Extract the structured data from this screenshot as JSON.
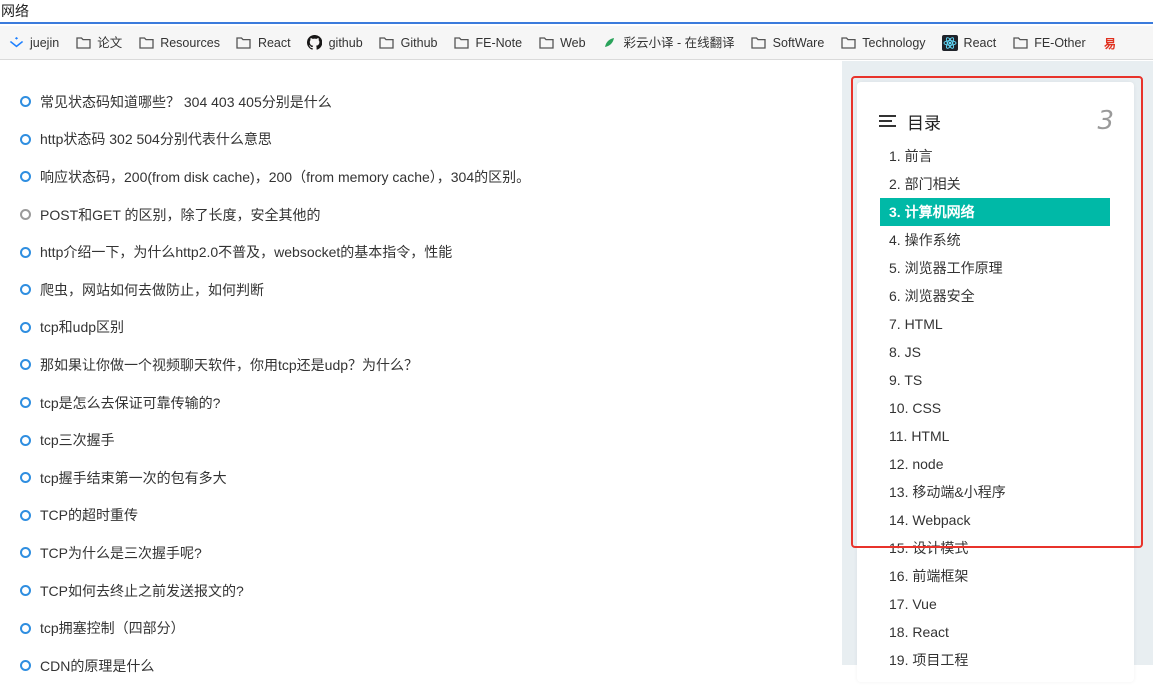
{
  "tab": {
    "title": "网络"
  },
  "bookmarks": [
    {
      "label": "juejin",
      "icon": "juejin-icon"
    },
    {
      "label": "论文",
      "icon": "folder-icon"
    },
    {
      "label": "Resources",
      "icon": "folder-icon"
    },
    {
      "label": "React",
      "icon": "folder-icon"
    },
    {
      "label": "github",
      "icon": "github-icon"
    },
    {
      "label": "Github",
      "icon": "folder-icon"
    },
    {
      "label": "FE-Note",
      "icon": "folder-icon"
    },
    {
      "label": "Web",
      "icon": "folder-icon"
    },
    {
      "label": "彩云小译 - 在线翻译",
      "icon": "caiyun-icon"
    },
    {
      "label": "SoftWare",
      "icon": "folder-icon"
    },
    {
      "label": "Technology",
      "icon": "folder-icon"
    },
    {
      "label": "React",
      "icon": "react-icon"
    },
    {
      "label": "FE-Other",
      "icon": "folder-icon"
    },
    {
      "label": "",
      "icon": "youdao-icon"
    }
  ],
  "questions": [
    {
      "text": "常见状态码知道哪些？ 304 403 405分别是什么",
      "bullet": "blue"
    },
    {
      "text": "http状态码 302 504分别代表什么意思",
      "bullet": "blue"
    },
    {
      "text": "响应状态码，200(from disk cache)，200（from memory cache），304的区别。",
      "bullet": "blue"
    },
    {
      "text": "POST和GET 的区别，除了长度，安全其他的",
      "bullet": "gray"
    },
    {
      "text": "http介绍一下，为什么http2.0不普及，websocket的基本指令，性能",
      "bullet": "blue"
    },
    {
      "text": "爬虫，网站如何去做防止，如何判断",
      "bullet": "blue"
    },
    {
      "text": "tcp和udp区别",
      "bullet": "blue"
    },
    {
      "text": "那如果让你做一个视频聊天软件，你用tcp还是udp？为什么？",
      "bullet": "blue"
    },
    {
      "text": "tcp是怎么去保证可靠传输的?",
      "bullet": "blue"
    },
    {
      "text": "tcp三次握手",
      "bullet": "blue"
    },
    {
      "text": "tcp握手结束第一次的包有多大",
      "bullet": "blue"
    },
    {
      "text": "TCP的超时重传",
      "bullet": "blue"
    },
    {
      "text": "TCP为什么是三次握手呢?",
      "bullet": "blue"
    },
    {
      "text": "TCP如何去终止之前发送报文的?",
      "bullet": "blue"
    },
    {
      "text": "tcp拥塞控制（四部分）",
      "bullet": "blue"
    },
    {
      "text": "CDN的原理是什么",
      "bullet": "blue"
    }
  ],
  "toc": {
    "title": "目录",
    "count": "3",
    "items": [
      "1. 前言",
      "2. 部门相关",
      "3. 计算机网络",
      "4. 操作系统",
      "5. 浏览器工作原理",
      "6. 浏览器安全",
      "7. HTML",
      "8. JS",
      "9. TS",
      "10. CSS",
      "11. HTML",
      "12. node",
      "13. 移动端&小程序",
      "14. Webpack",
      "15. 设计模式",
      "16. 前端框架",
      "17. Vue",
      "18. React",
      "19. 项目工程"
    ],
    "active_index": 2
  },
  "colors": {
    "accent": "#00b9a7",
    "bullet_blue": "#2f8ee0",
    "bullet_gray": "#9a9a9a",
    "highlight": "#e8332b"
  }
}
